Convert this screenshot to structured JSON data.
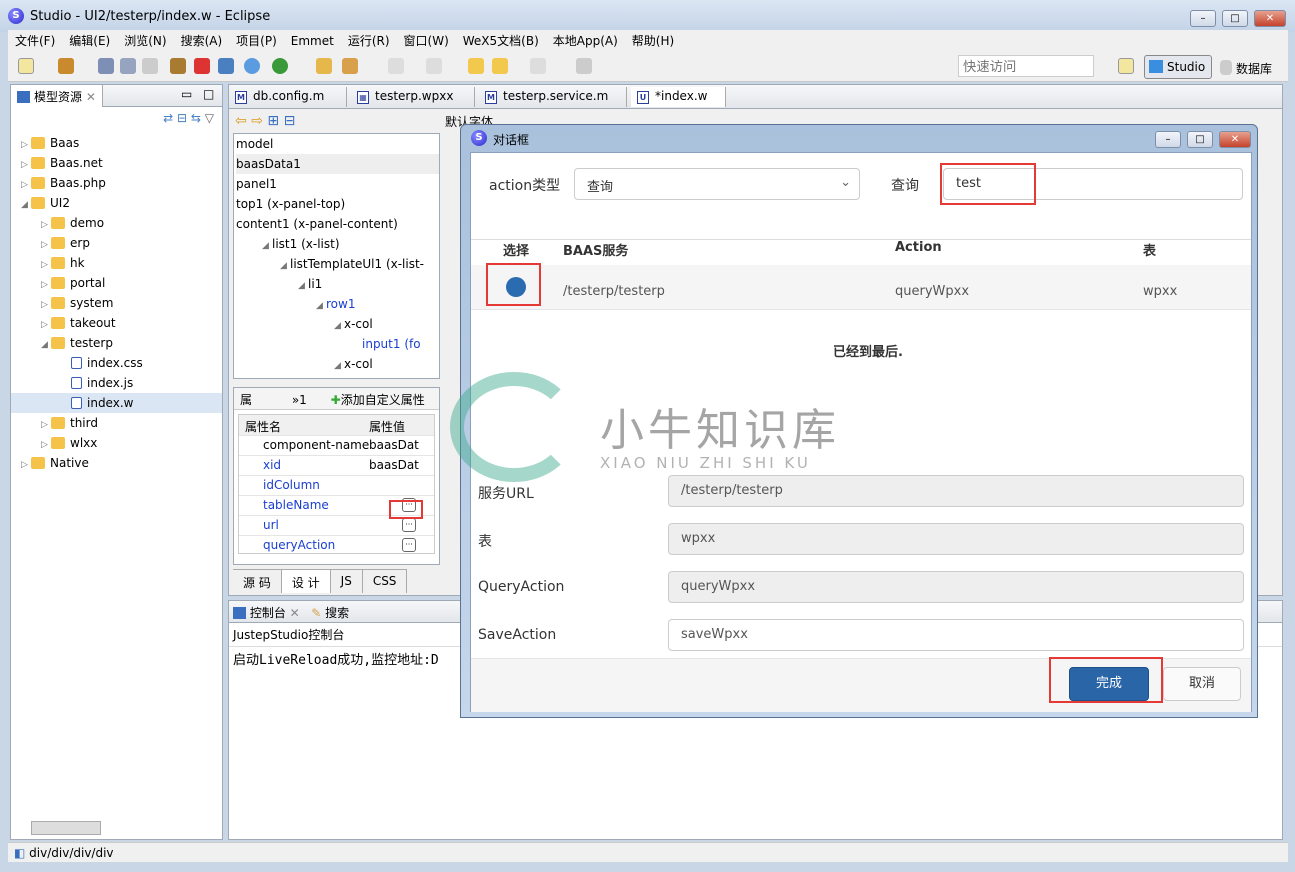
{
  "window": {
    "title": "Studio - UI2/testerp/index.w - Eclipse",
    "min": "–",
    "max": "□",
    "close": "✕"
  },
  "menu": [
    "文件(F)",
    "编辑(E)",
    "浏览(N)",
    "搜索(A)",
    "项目(P)",
    "Emmet",
    "运行(R)",
    "窗口(W)",
    "WeX5文档(B)",
    "本地App(A)",
    "帮助(H)"
  ],
  "toolbar": {
    "quick_access_placeholder": "快速访问",
    "perspective_studio": "Studio",
    "perspective_db": "数据库"
  },
  "left_panel": {
    "title": "模型资源",
    "items": [
      {
        "label": "Baas",
        "level": 0,
        "exp": "▷"
      },
      {
        "label": "Baas.net",
        "level": 0,
        "exp": "▷"
      },
      {
        "label": "Baas.php",
        "level": 0,
        "exp": "▷"
      },
      {
        "label": "UI2",
        "level": 0,
        "exp": "◢"
      },
      {
        "label": "demo",
        "level": 1,
        "exp": "▷"
      },
      {
        "label": "erp",
        "level": 1,
        "exp": "▷"
      },
      {
        "label": "hk",
        "level": 1,
        "exp": "▷"
      },
      {
        "label": "portal",
        "level": 1,
        "exp": "▷"
      },
      {
        "label": "system",
        "level": 1,
        "exp": "▷"
      },
      {
        "label": "takeout",
        "level": 1,
        "exp": "▷"
      },
      {
        "label": "testerp",
        "level": 1,
        "exp": "◢"
      },
      {
        "label": "index.css",
        "level": 2,
        "exp": ""
      },
      {
        "label": "index.js",
        "level": 2,
        "exp": ""
      },
      {
        "label": "index.w",
        "level": 2,
        "exp": ""
      },
      {
        "label": "third",
        "level": 1,
        "exp": "▷"
      },
      {
        "label": "wlxx",
        "level": 1,
        "exp": "▷"
      },
      {
        "label": "Native",
        "level": 0,
        "exp": "▷"
      }
    ]
  },
  "editor_tabs": [
    "db.config.m",
    "testerp.wpxx",
    "testerp.service.m",
    "*index.w"
  ],
  "editor_toolbar": {
    "font": "默认字体"
  },
  "outline": [
    "model",
    "baasData1",
    "panel1",
    "top1 (x-panel-top)",
    "content1 (x-panel-content)",
    "list1 (x-list)",
    "listTemplateUl1 (x-list-",
    "li1",
    "row1",
    "x-col",
    "input1 (fo",
    "x-col"
  ],
  "props": {
    "tab1": "属",
    "tab2": "»1",
    "add": "添加自定义属性",
    "col_name": "属性名",
    "col_value": "属性值",
    "rows": [
      {
        "name": "component-name",
        "value": "baasDat"
      },
      {
        "name": "xid",
        "value": "baasDat"
      },
      {
        "name": "idColumn",
        "value": ""
      },
      {
        "name": "tableName",
        "value": "···"
      },
      {
        "name": "url",
        "value": "···"
      },
      {
        "name": "queryAction",
        "value": "···"
      }
    ]
  },
  "bottom_tabs": [
    "源 码",
    "设 计",
    "JS",
    "CSS"
  ],
  "console": {
    "tab": "控制台",
    "tab2": "搜索",
    "header": "JustepStudio控制台",
    "line": "启动LiveReload成功,监控地址:D"
  },
  "status": "div/div/div/div",
  "dialog": {
    "title": "对话框",
    "action_type_label": "action类型",
    "action_type_value": "查询",
    "query_label": "查询",
    "query_value": "test",
    "headers": [
      "选择",
      "BAAS服务",
      "Action",
      "表"
    ],
    "row": {
      "service": "/testerp/testerp",
      "action": "queryWpxx",
      "table": "wpxx"
    },
    "end_text": "已经到最后.",
    "fields": [
      {
        "label": "服务URL",
        "value": "/testerp/testerp"
      },
      {
        "label": "表",
        "value": "wpxx"
      },
      {
        "label": "QueryAction",
        "value": "queryWpxx"
      },
      {
        "label": "SaveAction",
        "value": "saveWpxx"
      }
    ],
    "ok": "完成",
    "cancel": "取消"
  },
  "watermark": {
    "cn": "小牛知识库",
    "en": "XIAO NIU ZHI SHI KU"
  },
  "colors": {
    "accent": "#2b6cb0",
    "highlight": "#e53935",
    "primary_button": "#2a65a8"
  }
}
